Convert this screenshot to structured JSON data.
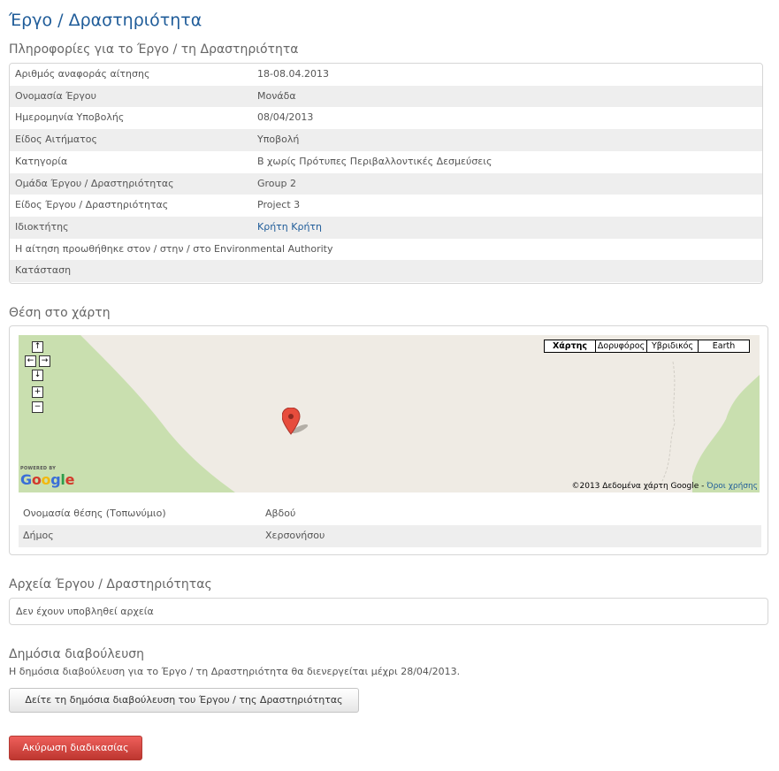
{
  "page_title": "Έργο / Δραστηριότητα",
  "info": {
    "section_title": "Πληροφορίες για το Έργο / τη Δραστηριότητα",
    "rows": [
      {
        "label": "Αριθμός αναφοράς αίτησης",
        "value": "18-08.04.2013"
      },
      {
        "label": "Ονομασία Έργου",
        "value": "Μονάδα"
      },
      {
        "label": "Ημερομηνία Υποβολής",
        "value": "08/04/2013"
      },
      {
        "label": "Είδος Αιτήματος",
        "value": "Υποβολή"
      },
      {
        "label": "Κατηγορία",
        "value": "Β χωρίς Πρότυπες Περιβαλλοντικές Δεσμεύσεις"
      },
      {
        "label": "Ομάδα Έργου / Δραστηριότητας",
        "value": "Group 2"
      },
      {
        "label": "Είδος Έργου / Δραστηριότητας",
        "value": "Project 3"
      },
      {
        "label": "Ιδιοκτήτης",
        "value": "Κρήτη Κρήτη"
      },
      {
        "label": "Η αίτηση προωθήθηκε στον / στην / στο Environmental Authority",
        "value": ""
      },
      {
        "label": "Κατάσταση",
        "value": ""
      }
    ]
  },
  "map": {
    "section_title": "Θέση στο χάρτη",
    "nav": {
      "up": "↑",
      "left": "←",
      "right": "→",
      "down": "↓",
      "zoom_in": "+",
      "zoom_out": "−"
    },
    "types": [
      "Χάρτης",
      "Δορυφόρος",
      "Υβριδικός",
      "Earth"
    ],
    "powered_by": "POWERED BY",
    "copyright": "©2013 Δεδομένα χάρτη Google - ",
    "terms_link": "Όροι χρήσης",
    "land_color": "#c9dfaf",
    "pin_color": "#e74c3c"
  },
  "location": {
    "rows": [
      {
        "label": "Ονομασία θέσης (Τοπωνύμιο)",
        "value": "Αβδού"
      },
      {
        "label": "Δήμος",
        "value": "Χερσονήσου"
      }
    ]
  },
  "files": {
    "section_title": "Αρχεία Έργου / Δραστηριότητας",
    "empty_text": "Δεν έχουν υποβληθεί αρχεία"
  },
  "consultation": {
    "section_title": "Δημόσια διαβούλευση",
    "text": "Η δημόσια διαβούλευση για το Έργο / τη Δραστηριότητα θα διενεργείται μέχρι 28/04/2013.",
    "button_label": "Δείτε τη δημόσια διαβούλευση του Έργου / της Δραστηριότητας"
  },
  "cancel_button_label": "Ακύρωση διαδικασίας"
}
